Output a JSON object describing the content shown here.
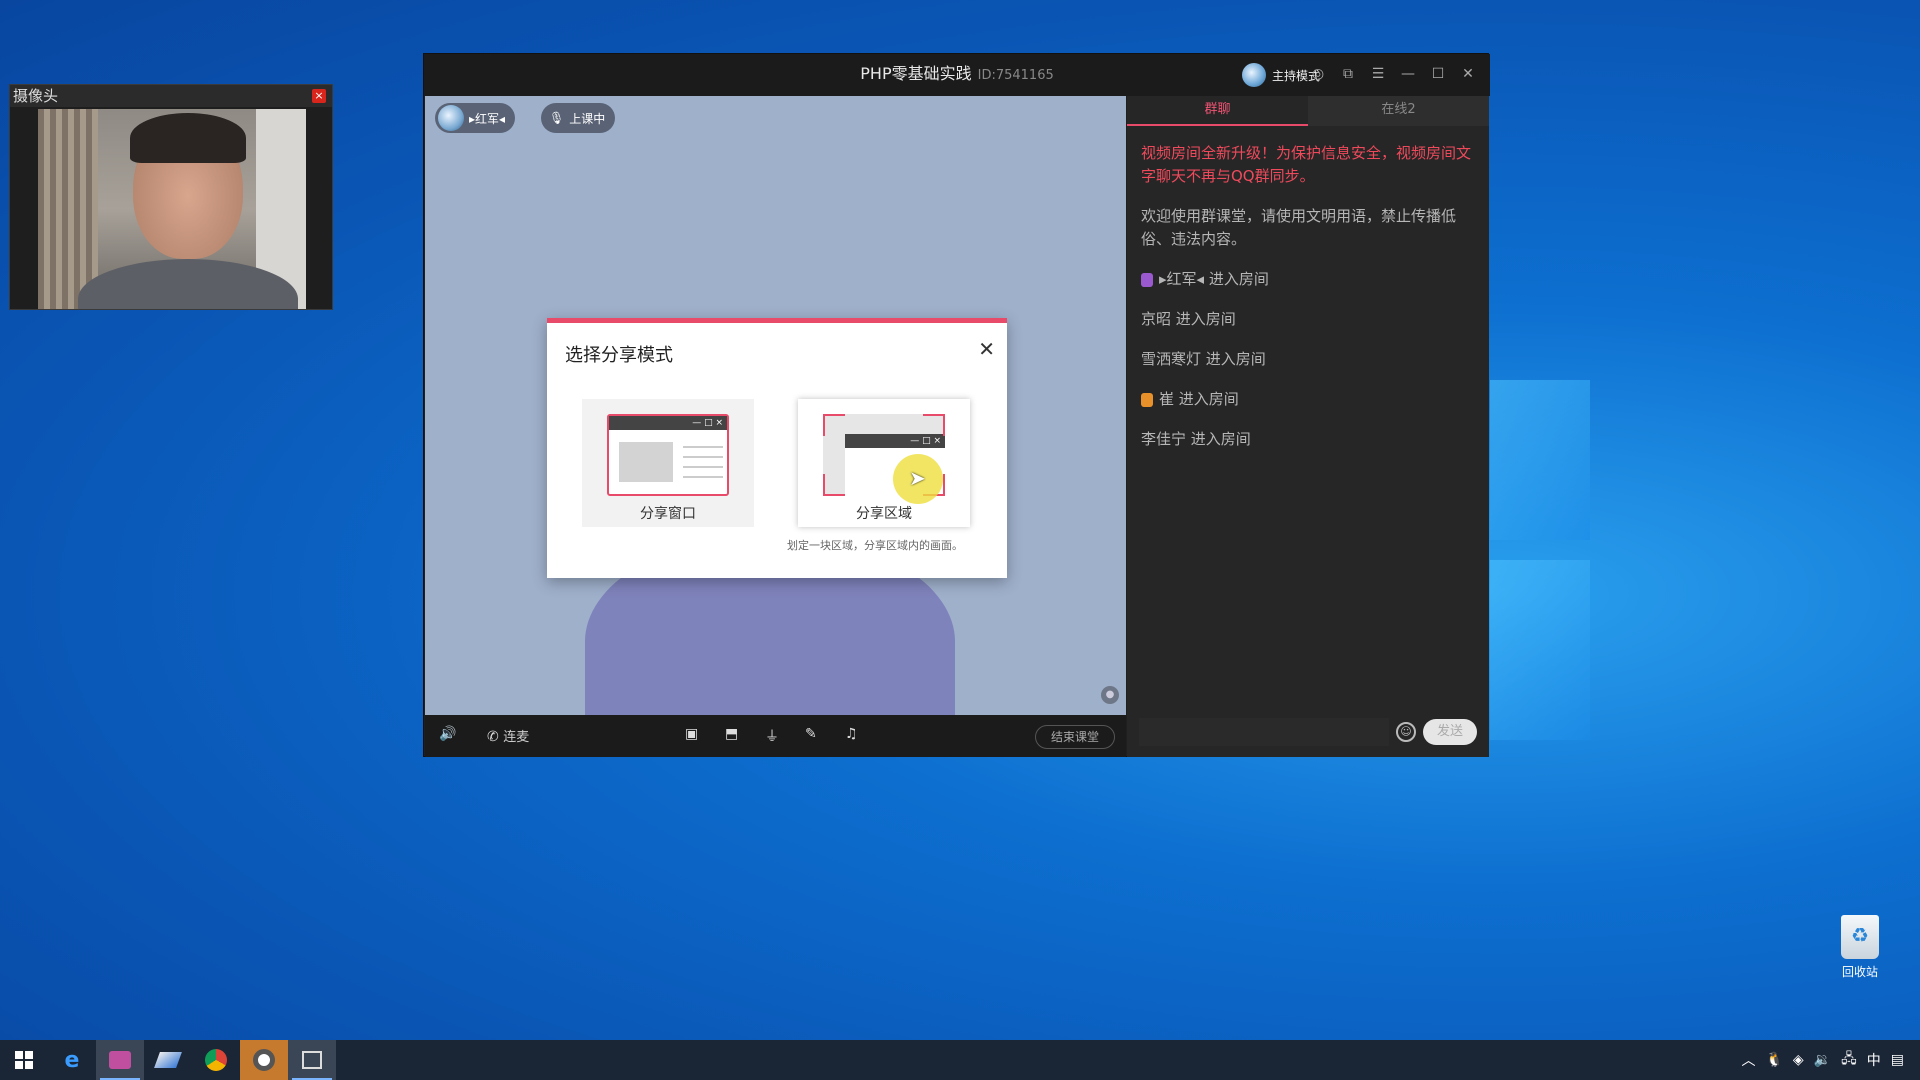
{
  "camera": {
    "title": "摄像头",
    "close": "×"
  },
  "app": {
    "title": "PHP零基础实践",
    "room_id": "ID:7541165",
    "host_mode": "主持模式",
    "stage": {
      "user_chip": "▸红军◂",
      "live_chip": "上课中"
    },
    "toolbar": {
      "call_label": "连麦",
      "end_button": "结束课堂"
    }
  },
  "dialog": {
    "title": "选择分享模式",
    "option_window": "分享窗口",
    "option_area": "分享区域",
    "hint": "划定一块区域，分享区域内的画面。",
    "mini_controls": "— □ ×"
  },
  "chat": {
    "tabs": [
      {
        "label": "群聊",
        "active": true
      },
      {
        "label": "在线2",
        "active": false
      }
    ],
    "notice": "视频房间全新升级！为保护信息安全，视频房间文字聊天不再与QQ群同步。",
    "welcome": "欢迎使用群课堂，请使用文明用语，禁止传播低俗、违法内容。",
    "entries": [
      {
        "text": "▸红军◂ 进入房间",
        "badge": "#9b59d0"
      },
      {
        "text": "京昭 进入房间",
        "badge": ""
      },
      {
        "text": "雪洒寒灯 进入房间",
        "badge": ""
      },
      {
        "text": "崔 进入房间",
        "badge": "#e8902a"
      },
      {
        "text": "李佳宁 进入房间",
        "badge": ""
      }
    ],
    "send": "发送"
  },
  "desktop": {
    "recycle_bin": "回收站"
  },
  "taskbar": {
    "ime": "中"
  },
  "colors": {
    "accent": "#e84a6a",
    "notice": "#ef4a5c",
    "desktop": "#0a56b5"
  }
}
